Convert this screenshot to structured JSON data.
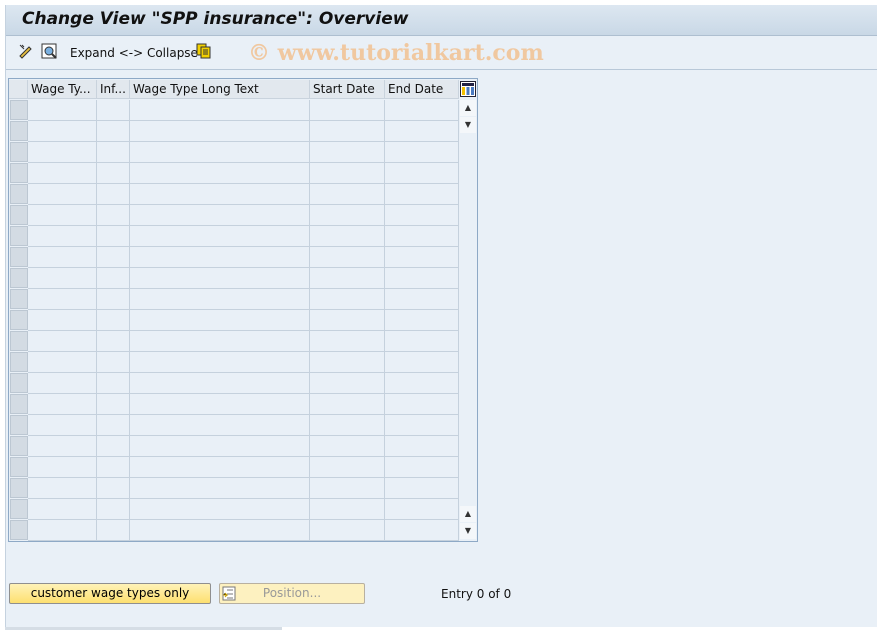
{
  "title": "Change View \"SPP insurance\": Overview",
  "toolbar": {
    "expand_collapse": "Expand <-> Collapse",
    "icons": [
      "change-display-icon",
      "find-icon",
      "copy-icon"
    ]
  },
  "watermark": "© www.tutorialkart.com",
  "table": {
    "columns": [
      "Wage Ty...",
      "Inf...",
      "Wage Type Long Text",
      "Start Date",
      "End Date"
    ],
    "rows": []
  },
  "buttons": {
    "customer": "customer wage types only",
    "position": "Position..."
  },
  "status": {
    "entry": "Entry 0 of 0"
  },
  "colors": {
    "button": "#fde98a",
    "title_bar": "#c9d8e6",
    "background": "#e9f0f7"
  }
}
